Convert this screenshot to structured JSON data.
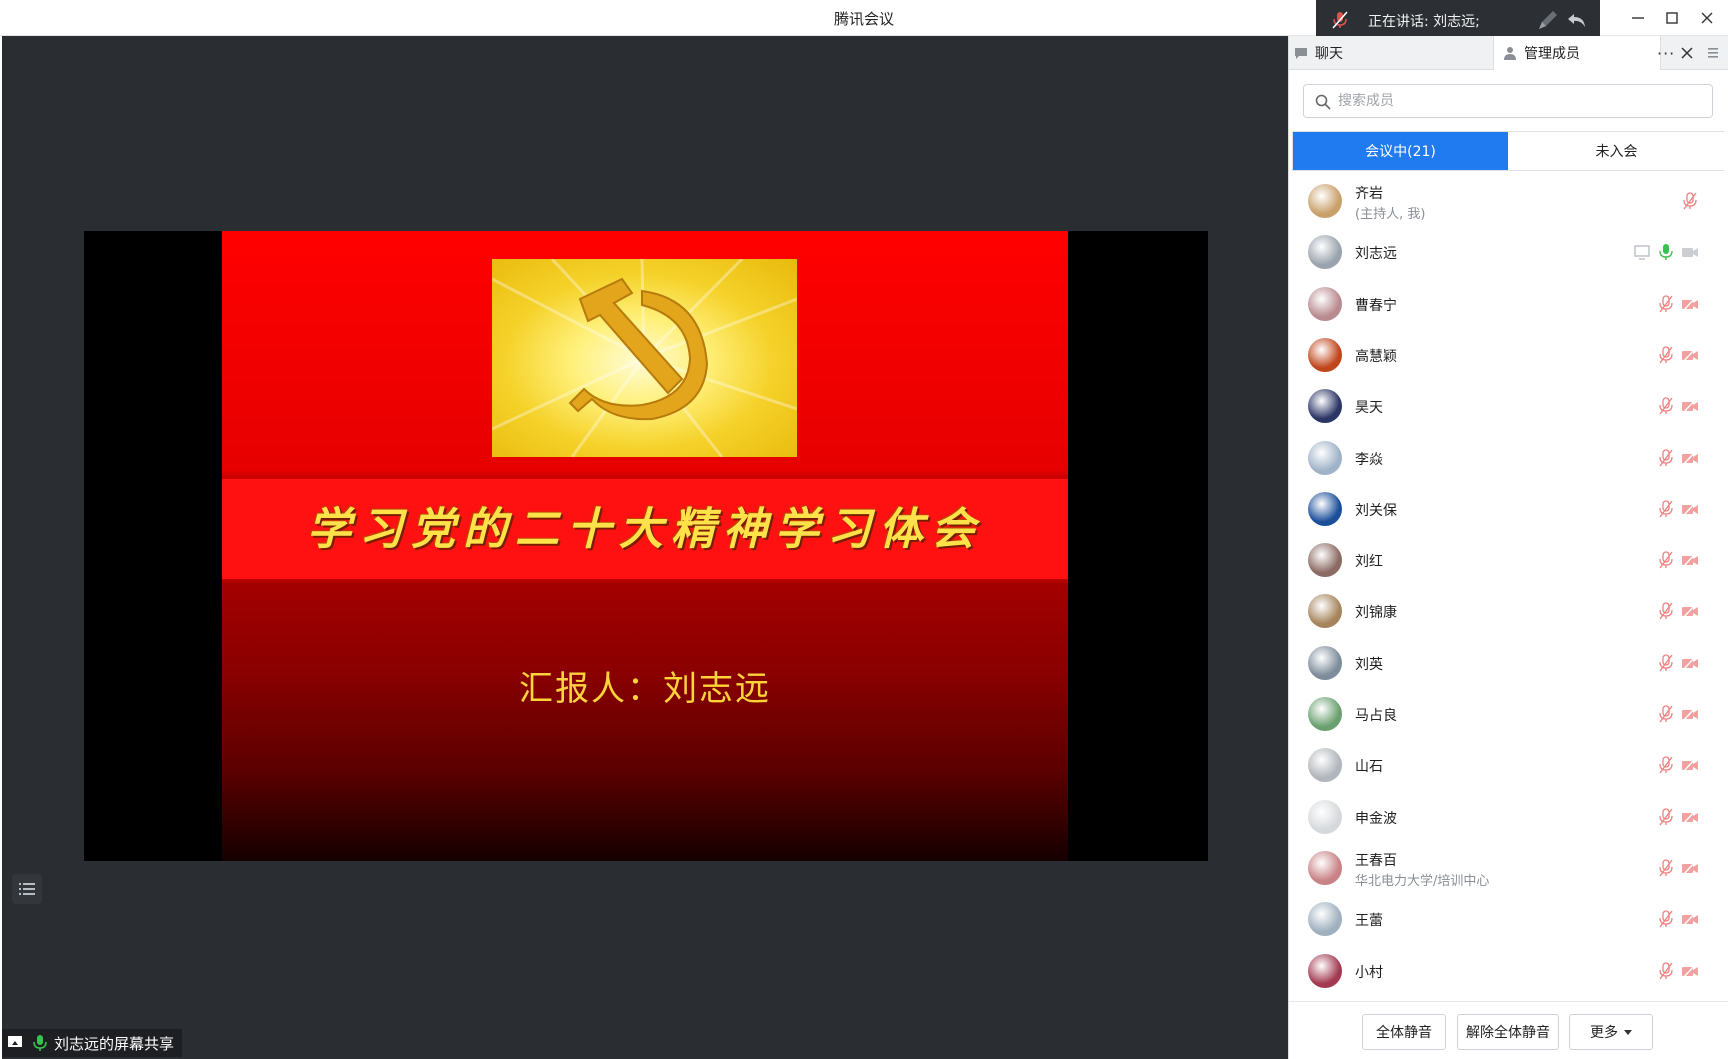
{
  "window": {
    "title": "腾讯会议",
    "speaking_label": "正在讲话: 刘志远;"
  },
  "slide": {
    "title": "学习党的二十大精神学习体会",
    "reporter": "汇报人：刘志远"
  },
  "share_status": "刘志远的屏幕共享",
  "panel": {
    "tabs": {
      "chat": "聊天",
      "members": "管理成员",
      "more": "···"
    },
    "search_placeholder": "搜索成员",
    "segments": {
      "in_meeting": "会议中(21)",
      "not_joined": "未入会"
    },
    "members": [
      {
        "name": "齐岩",
        "sub": "(主持人, 我)",
        "avatar_color": "#c9a06a",
        "mic": "muted",
        "cam": "none"
      },
      {
        "name": "刘志远",
        "sub": "",
        "avatar_color": "#9aa3ad",
        "mic": "active",
        "cam": "off-gray",
        "share": true
      },
      {
        "name": "曹春宁",
        "sub": "",
        "avatar_color": "#b98a8f",
        "mic": "muted",
        "cam": "off"
      },
      {
        "name": "高慧颖",
        "sub": "",
        "avatar_color": "#c0461c",
        "mic": "muted",
        "cam": "off"
      },
      {
        "name": "昊天",
        "sub": "",
        "avatar_color": "#2b3566",
        "mic": "muted",
        "cam": "off"
      },
      {
        "name": "李焱",
        "sub": "",
        "avatar_color": "#9fb3c8",
        "mic": "muted",
        "cam": "off"
      },
      {
        "name": "刘关保",
        "sub": "",
        "avatar_color": "#1c4f9a",
        "mic": "muted",
        "cam": "off"
      },
      {
        "name": "刘红",
        "sub": "",
        "avatar_color": "#8a6a62",
        "mic": "muted",
        "cam": "off"
      },
      {
        "name": "刘锦康",
        "sub": "",
        "avatar_color": "#a5845c",
        "mic": "muted",
        "cam": "off"
      },
      {
        "name": "刘英",
        "sub": "",
        "avatar_color": "#7d8c9a",
        "mic": "muted",
        "cam": "off"
      },
      {
        "name": "马占良",
        "sub": "",
        "avatar_color": "#6aa070",
        "mic": "muted",
        "cam": "off"
      },
      {
        "name": "山石",
        "sub": "",
        "avatar_color": "#b0b6bb",
        "mic": "muted",
        "cam": "off"
      },
      {
        "name": "申金波",
        "sub": "",
        "avatar_color": "#d6d9dc",
        "mic": "muted",
        "cam": "off"
      },
      {
        "name": "王春百",
        "sub": "华北电力大学/培训中心",
        "avatar_color": "#c98286",
        "mic": "muted",
        "cam": "off"
      },
      {
        "name": "王蕾",
        "sub": "",
        "avatar_color": "#9fb0bf",
        "mic": "muted",
        "cam": "off"
      },
      {
        "name": "小村",
        "sub": "",
        "avatar_color": "#a33a52",
        "mic": "muted",
        "cam": "off"
      }
    ],
    "footer": {
      "mute_all": "全体静音",
      "unmute_all": "解除全体静音",
      "more": "更多"
    }
  },
  "colors": {
    "accent": "#1f7bef",
    "muted_icon": "#f08080",
    "active_mic": "#35c24d",
    "stage_bg": "#2a2d31"
  }
}
